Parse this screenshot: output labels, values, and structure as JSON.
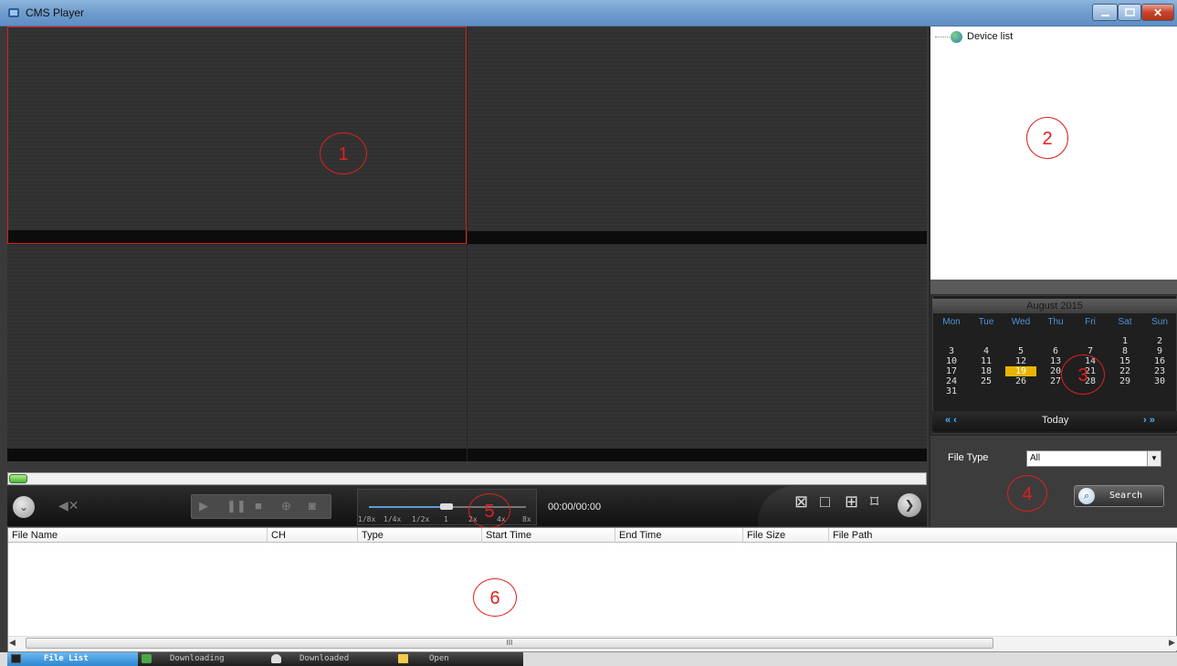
{
  "window": {
    "title": "CMS Player",
    "close_glyph": "✕",
    "minimize_icon": "minimize-icon",
    "maximize_icon": "maximize-icon"
  },
  "annotations": [
    "1",
    "2",
    "3",
    "4",
    "5",
    "6"
  ],
  "device_panel": {
    "root_label": "Device list",
    "root_icon": "globe-icon"
  },
  "calendar": {
    "month_label": "August  2015",
    "weekdays": [
      "Mon",
      "Tue",
      "Wed",
      "Thu",
      "Fri",
      "Sat",
      "Sun"
    ],
    "weeks": [
      [
        "",
        "",
        "",
        "",
        "",
        "1",
        "2"
      ],
      [
        "3",
        "4",
        "5",
        "6",
        "7",
        "8",
        "9"
      ],
      [
        "10",
        "11",
        "12",
        "13",
        "14",
        "15",
        "16"
      ],
      [
        "17",
        "18",
        "19",
        "20",
        "21",
        "22",
        "23"
      ],
      [
        "24",
        "25",
        "26",
        "27",
        "28",
        "29",
        "30"
      ],
      [
        "31",
        "",
        "",
        "",
        "",
        "",
        ""
      ]
    ],
    "selected_day": "19",
    "prev_label": "« ‹",
    "today_label": "Today",
    "next_label": "› »",
    "colors": {
      "weekday": "#4d93d8",
      "selected": "#e8b400",
      "nav": "#39b8ff"
    }
  },
  "search": {
    "file_type_label": "File Type",
    "file_type_value": "All",
    "search_label": "Search"
  },
  "playback": {
    "time": "00:00/00:00",
    "speed_labels": [
      "1/8x",
      "1/4x",
      "1/2x",
      "1",
      "2x",
      "4x",
      "8x"
    ],
    "speed_current": "1",
    "progress_fraction": 0
  },
  "file_list": {
    "columns": [
      "File Name",
      "CH",
      "Type",
      "Start Time",
      "End Time",
      "File Size",
      "File Path"
    ],
    "rows": [],
    "scroll_grip": "III"
  },
  "tabs": [
    {
      "label": "File List",
      "icon": "film-icon",
      "active": true
    },
    {
      "label": "Downloading",
      "icon": "download-icon",
      "active": false
    },
    {
      "label": "Downloaded",
      "icon": "cloud-icon",
      "active": false
    },
    {
      "label": "Open",
      "icon": "folder-icon",
      "active": false
    }
  ],
  "colors": {
    "accent": "#e02020",
    "title_bar": "#6f9ccc",
    "tab_active": "#2e86d0"
  }
}
